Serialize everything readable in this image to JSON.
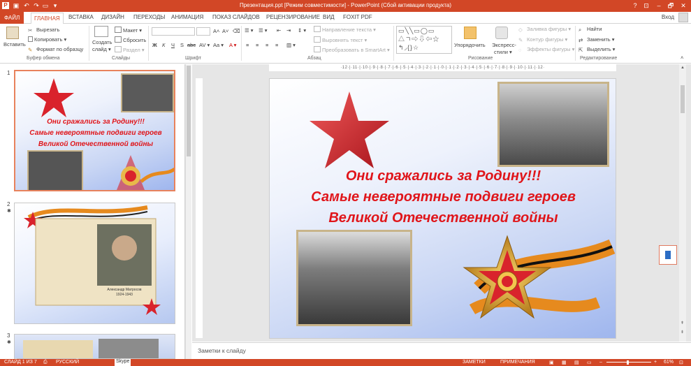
{
  "window": {
    "title": "Презентация.ppt [Режим совместимости] - PowerPoint (Сбой активации продукта)",
    "controls": [
      "?",
      "⊡",
      "–",
      "🗗",
      "✕"
    ]
  },
  "tabs": [
    {
      "label": "ФАЙЛ"
    },
    {
      "label": "ГЛАВНАЯ"
    },
    {
      "label": "ВСТАВКА"
    },
    {
      "label": "ДИЗАЙН"
    },
    {
      "label": "ПЕРЕХОДЫ"
    },
    {
      "label": "АНИМАЦИЯ"
    },
    {
      "label": "ПОКАЗ СЛАЙДОВ"
    },
    {
      "label": "РЕЦЕНЗИРОВАНИЕ"
    },
    {
      "label": "ВИД"
    },
    {
      "label": "FOXIT PDF"
    }
  ],
  "signin": "Вход",
  "ribbon": {
    "clipboard": {
      "paste": "Вставить",
      "cut": "Вырезать",
      "copy": "Копировать ▾",
      "format": "Формат по образцу",
      "group": "Буфер обмена"
    },
    "slides": {
      "create": "Создать",
      "create2": "слайд ▾",
      "layout": "Макет ▾",
      "reset": "Сбросить",
      "section": "Раздел ▾",
      "group": "Слайды"
    },
    "font": {
      "bold": "Ж",
      "italic": "К",
      "underline": "Ч",
      "strike": "S",
      "abc": "abc",
      "spacing": "AV ▾",
      "case": "Aa ▾",
      "color": "A ▾",
      "grow": "A˄",
      "shrink": "A˅",
      "group": "Шрифт"
    },
    "paragraph": {
      "direction": "Направление текста ▾",
      "align": "Выровнять текст ▾",
      "smartart": "Преобразовать в SmartArt ▾",
      "group": "Абзац"
    },
    "drawing": {
      "arrange": "Упорядочить",
      "styles1": "Экспресс-",
      "styles2": "стили ▾",
      "fill": "Заливка фигуры ▾",
      "outline": "Контур фигуры ▾",
      "effects": "Эффекты фигуры ▾",
      "group": "Рисование"
    },
    "editing": {
      "find": "Найти",
      "replace": "Заменить ▾",
      "select": "Выделить ▾",
      "group": "Редактирование"
    }
  },
  "thumbnails": [
    {
      "number": "1",
      "selected": true
    },
    {
      "number": "2",
      "selected": false
    },
    {
      "number": "3",
      "selected": false
    }
  ],
  "thumb2_caption": {
    "name": "Александр Матросов",
    "years": "1924-1943"
  },
  "ruler": "·12·|·11·|·10·|·9·|·8·|·7·|·6·|·5·|·4·|·3·|·2·|·1·|·0·|·1·|·2·|·3·|·4·|·5·|·6·|·7·|·8·|·9·|·10·|·11·|·12·",
  "slide": {
    "line1": "Они сражались за Родину!!!",
    "line2": "Самые невероятные подвиги героев",
    "line3": "Великой Отечественной войны",
    "title_color": "#e0151a",
    "star_color": "#d9232c"
  },
  "notes": "Заметки к слайду",
  "status": {
    "slide": "СЛАЙД 1 ИЗ 7",
    "language": "РУССКИЙ",
    "key": "Skype",
    "notes": "ЗАМЕТКИ",
    "comments": "ПРИМЕЧАНИЯ",
    "zoom": "61%"
  },
  "accent": "#d24726"
}
